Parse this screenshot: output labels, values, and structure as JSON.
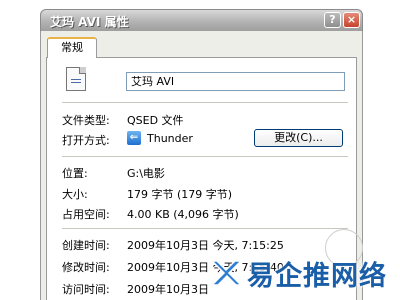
{
  "window": {
    "title": "艾玛 AVI 属性",
    "help_label": "?",
    "close_label": "×"
  },
  "tabs": [
    {
      "label": "常规"
    }
  ],
  "file": {
    "name": "艾玛 AVI",
    "icon": "avi-file-icon"
  },
  "fields": {
    "type_label": "文件类型:",
    "type_value": "QSED 文件",
    "opens_with_label": "打开方式:",
    "opens_with_value": "Thunder",
    "opens_with_icon": "thunder-app-icon",
    "change_label": "更改(C)...",
    "location_label": "位置:",
    "location_value": "G:\\电影",
    "size_label": "大小:",
    "size_value": "179 字节 (179 字节)",
    "size_on_disk_label": "占用空间:",
    "size_on_disk_value": "4.00 KB (4,096 字节)",
    "created_label": "创建时间:",
    "created_value": "2009年10月3日 今天, 7:15:25",
    "modified_label": "修改时间:",
    "modified_value": "2009年10月3日 今天, 7:15:40",
    "accessed_label": "访问时间:",
    "accessed_value": "2009年10月3日"
  },
  "watermark": {
    "text": "易企推网络",
    "color": "#1a5ea8"
  }
}
